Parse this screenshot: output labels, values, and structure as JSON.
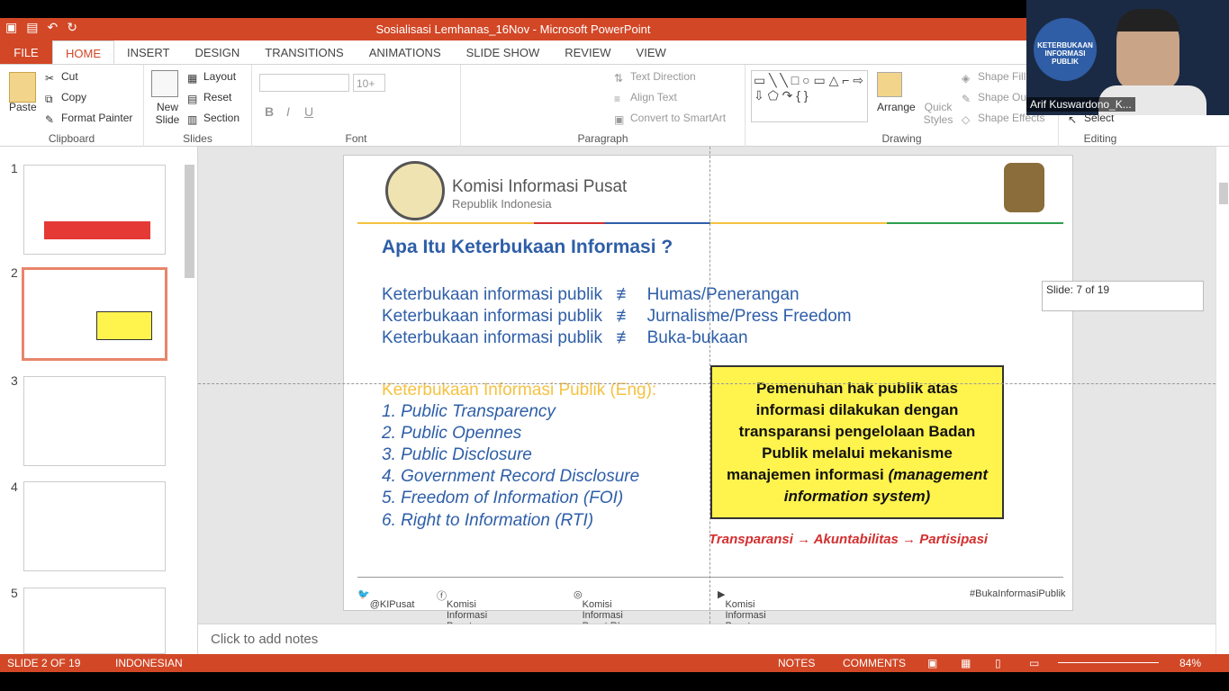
{
  "window": {
    "title": "Sosialisasi Lemhanas_16Nov - Microsoft PowerPoint"
  },
  "tabs": [
    "FILE",
    "HOME",
    "INSERT",
    "DESIGN",
    "TRANSITIONS",
    "ANIMATIONS",
    "SLIDE SHOW",
    "REVIEW",
    "VIEW"
  ],
  "ribbon": {
    "clipboard": {
      "paste": "Paste",
      "cut": "Cut",
      "copy": "Copy",
      "format_painter": "Format Painter",
      "label": "Clipboard"
    },
    "slides": {
      "new_slide": "New Slide",
      "layout": "Layout",
      "reset": "Reset",
      "section": "Section",
      "label": "Slides"
    },
    "font": {
      "size": "10+",
      "label": "Font"
    },
    "paragraph": {
      "text_direction": "Text Direction",
      "align_text": "Align Text",
      "convert": "Convert to SmartArt",
      "label": "Paragraph"
    },
    "drawing": {
      "arrange": "Arrange",
      "quick_styles": "Quick Styles",
      "shape_fill": "Shape Fill",
      "shape_outline": "Shape Out",
      "shape_effects": "Shape Effects",
      "label": "Drawing"
    },
    "editing": {
      "select": "Select",
      "label": "Editing"
    }
  },
  "video": {
    "participant": "Arif Kuswardono_K..."
  },
  "thumbnails": [
    "1",
    "2",
    "3",
    "4",
    "5"
  ],
  "slide": {
    "org_name": "Komisi Informasi Pusat",
    "org_sub": "Republik Indonesia",
    "title": "Apa Itu Keterbukaan Informasi  ?",
    "lines": [
      {
        "left": "Keterbukaan informasi publik",
        "right": "Humas/Penerangan"
      },
      {
        "left": "Keterbukaan informasi publik",
        "right": "Jurnalisme/Press Freedom"
      },
      {
        "left": "Keterbukaan informasi publik",
        "right": "Buka-bukaan"
      }
    ],
    "eng_heading": "Keterbukaan Informasi Publik (Eng):",
    "list": [
      "1.  Public Transparency",
      "2.  Public Opennes",
      "3.  Public Disclosure",
      "4.  Government Record Disclosure",
      "5.  Freedom of Information (FOI)",
      "6.  Right to Information (RTI)"
    ],
    "box_text": "Pemenuhan hak publik atas informasi dilakukan dengan transparansi pengelolaan Badan Publik melalui mekanisme manajemen informasi",
    "box_italic": "(management information system)",
    "tap": "Transparansi → Akuntabilitas → Partisipasi",
    "footer": {
      "twitter": "@KIPusat",
      "facebook": "Komisi Informasi Pusat",
      "instagram": "Komisi Informasi Pusat RI",
      "youtube": "Komisi Informasi Pusat",
      "hashtag": "#BukaInformasiPublik"
    }
  },
  "tooltip": "Slide: 7 of 19",
  "notes_placeholder": "Click to add notes",
  "status": {
    "slide": "SLIDE 2 OF 19",
    "language": "INDONESIAN",
    "notes": "NOTES",
    "comments": "COMMENTS",
    "zoom": "84%"
  }
}
